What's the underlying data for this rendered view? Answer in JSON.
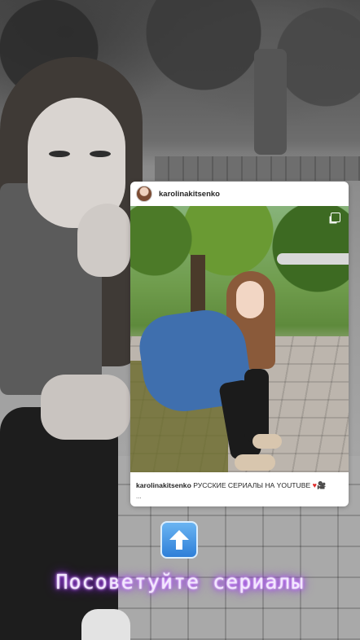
{
  "post": {
    "username": "karolinakitsenko",
    "caption_user": "karolinakitsenko",
    "caption_text": "РУССКИЕ СЕРИАЛЫ НА YOUTUBE",
    "caption_emojis": [
      "heart",
      "movie-camera"
    ],
    "ellipsis": "..."
  },
  "sticker": {
    "icon": "up-arrow-icon",
    "text": "Посоветуйте сериалы"
  },
  "colors": {
    "neon_glow": "#9b2cff",
    "arrow_bg": "#2e7fd8",
    "heart": "#e02b2b"
  }
}
